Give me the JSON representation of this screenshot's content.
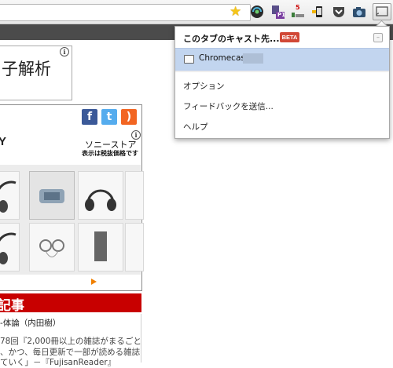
{
  "browser": {
    "extensions": [
      {
        "name": "bookmark-star",
        "icon": "star-icon"
      },
      {
        "name": "ext-dark-globe",
        "icon": "globe-icon"
      },
      {
        "name": "ext-p1",
        "icon": "p1-icon",
        "badge": "P1"
      },
      {
        "name": "ext-counter",
        "icon": "counter-icon",
        "badge": "5"
      },
      {
        "name": "ext-phone",
        "icon": "phone-icon"
      },
      {
        "name": "ext-pocket",
        "icon": "pocket-icon"
      },
      {
        "name": "ext-camera",
        "icon": "camera-icon"
      },
      {
        "name": "cast",
        "icon": "cast-icon"
      }
    ]
  },
  "page": {
    "headline": "子解析",
    "store_name": "ソニーストア",
    "store_sub": "表示は税抜価格です",
    "brand": "Y",
    "section_title": "記事",
    "articles": [
      "-体論（内田樹）",
      "78回『2,000冊以上の雑誌がまるごと",
      "、かつ、毎日更新で一部が読める雑誌",
      "ていく」－『FujisanReader』"
    ],
    "social": [
      "f",
      "t",
      "rss"
    ]
  },
  "cast_popup": {
    "title": "このタブのキャスト先...",
    "beta_label": "BETA",
    "device_name": "Chromecast",
    "menu": [
      "オプション",
      "フィードバックを送信...",
      "ヘルプ"
    ]
  },
  "colors": {
    "beta": "#d14836",
    "device_highlight": "#c2d5ef",
    "section_red": "#c80000"
  }
}
